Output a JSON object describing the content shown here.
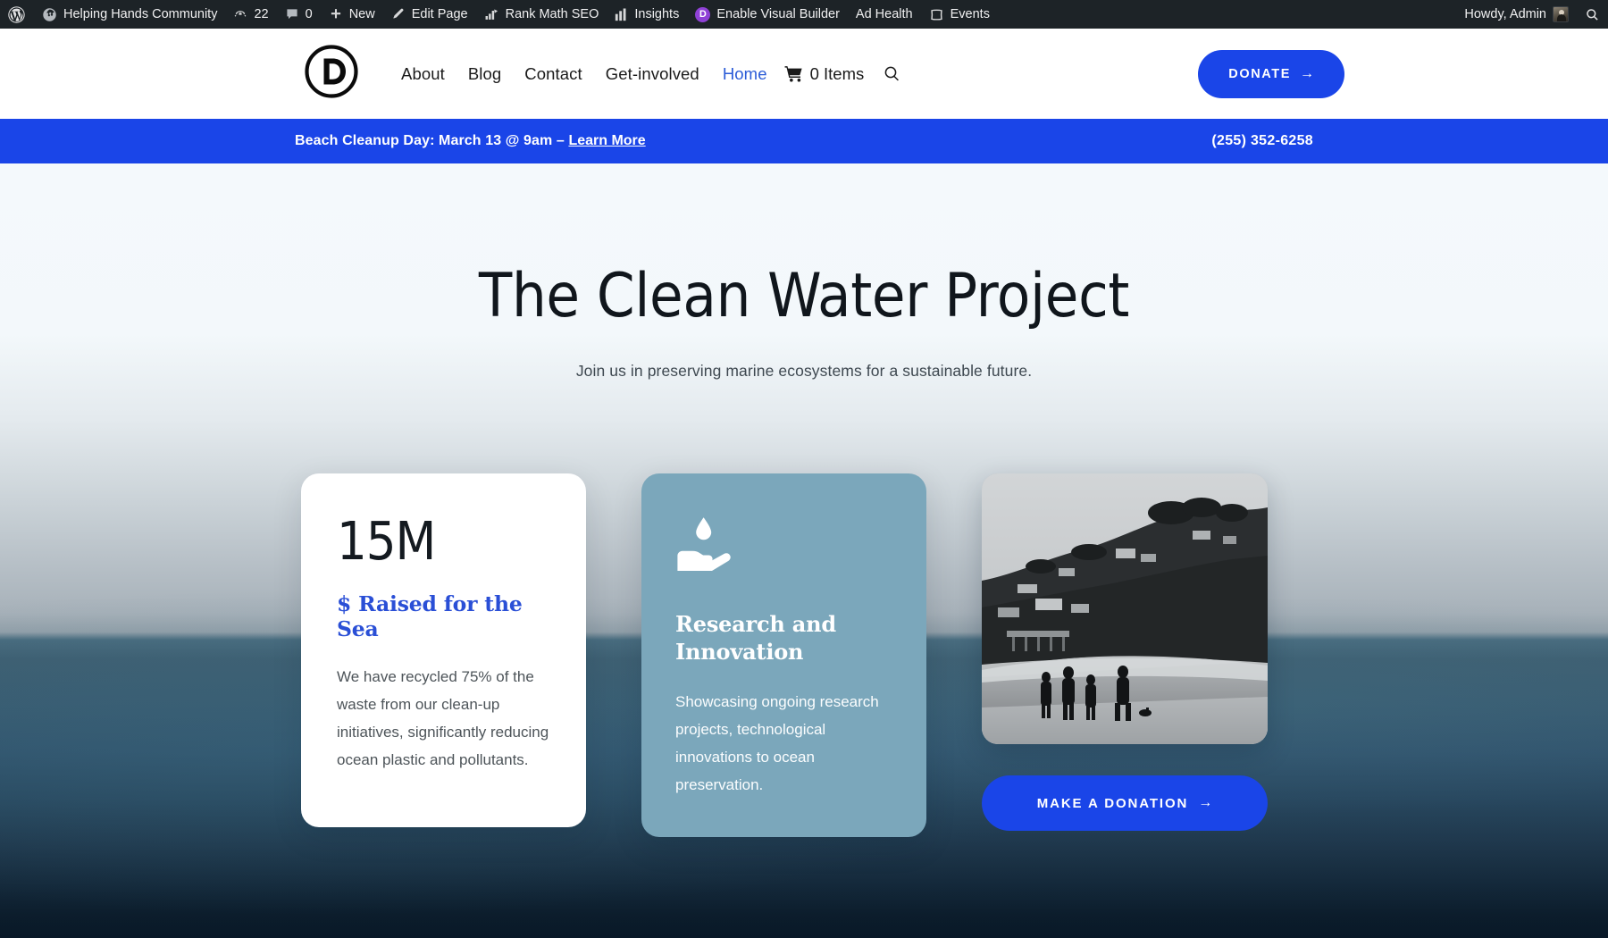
{
  "admin_bar": {
    "items": [
      {
        "name": "wordpress-logo",
        "icon": "wordpress-icon",
        "label": ""
      },
      {
        "name": "site-name",
        "icon": "site-icon",
        "label": "Helping Hands Community"
      },
      {
        "name": "updates",
        "icon": "updates-icon",
        "label": "22"
      },
      {
        "name": "comments",
        "icon": "comment-bubble-icon",
        "label": "0"
      },
      {
        "name": "new-content",
        "icon": "plus-icon",
        "label": "New"
      },
      {
        "name": "edit-page",
        "icon": "pencil-icon",
        "label": "Edit Page"
      },
      {
        "name": "rank-math-seo",
        "icon": "rankmath-icon",
        "label": "Rank Math SEO"
      },
      {
        "name": "insights",
        "icon": "bar-chart-icon",
        "label": "Insights"
      },
      {
        "name": "enable-visual-builder",
        "icon": "divi-icon",
        "label": "Enable Visual Builder"
      },
      {
        "name": "ad-health",
        "icon": "",
        "label": "Ad Health"
      },
      {
        "name": "events",
        "icon": "calendar-icon",
        "label": "Events"
      }
    ],
    "howdy": "Howdy, Admin",
    "search_icon": "search-icon"
  },
  "header": {
    "logo_letter": "D",
    "nav": [
      {
        "label": "About",
        "current": false
      },
      {
        "label": "Blog",
        "current": false
      },
      {
        "label": "Contact",
        "current": false
      },
      {
        "label": "Get-involved",
        "current": false
      },
      {
        "label": "Home",
        "current": true
      }
    ],
    "cart_label": "0 Items",
    "search_icon": "search-icon",
    "donate_label": "DONATE",
    "donate_arrow": "→",
    "accent_color": "#1a45e8"
  },
  "announcement": {
    "text": "Beach Cleanup Day: March 13 @ 9am – ",
    "link_label": "Learn More",
    "phone": "(255) 352-6258",
    "bg_color": "#1a45e8"
  },
  "hero": {
    "title": "The Clean Water Project",
    "subtitle": "Join us in preserving marine ecosystems for a sustainable future."
  },
  "cards": {
    "stat": {
      "number": "15M",
      "label": "$ Raised for the Sea",
      "body": "We have recycled 75% of the waste from our clean-up initiatives, significantly reducing ocean plastic and pollutants.",
      "label_color": "#2a4fd6"
    },
    "research": {
      "icon": "hand-holding-water-drop-icon",
      "title": "Research and Innovation",
      "body": "Showcasing ongoing research projects, technological innovations to ocean preservation.",
      "bg_color": "#7ba7bb"
    },
    "media": {
      "image_alt": "black-and-white-beach-coastline-photo",
      "cta_label": "MAKE A DONATION",
      "cta_arrow": "→",
      "cta_color": "#1a45e8"
    }
  }
}
